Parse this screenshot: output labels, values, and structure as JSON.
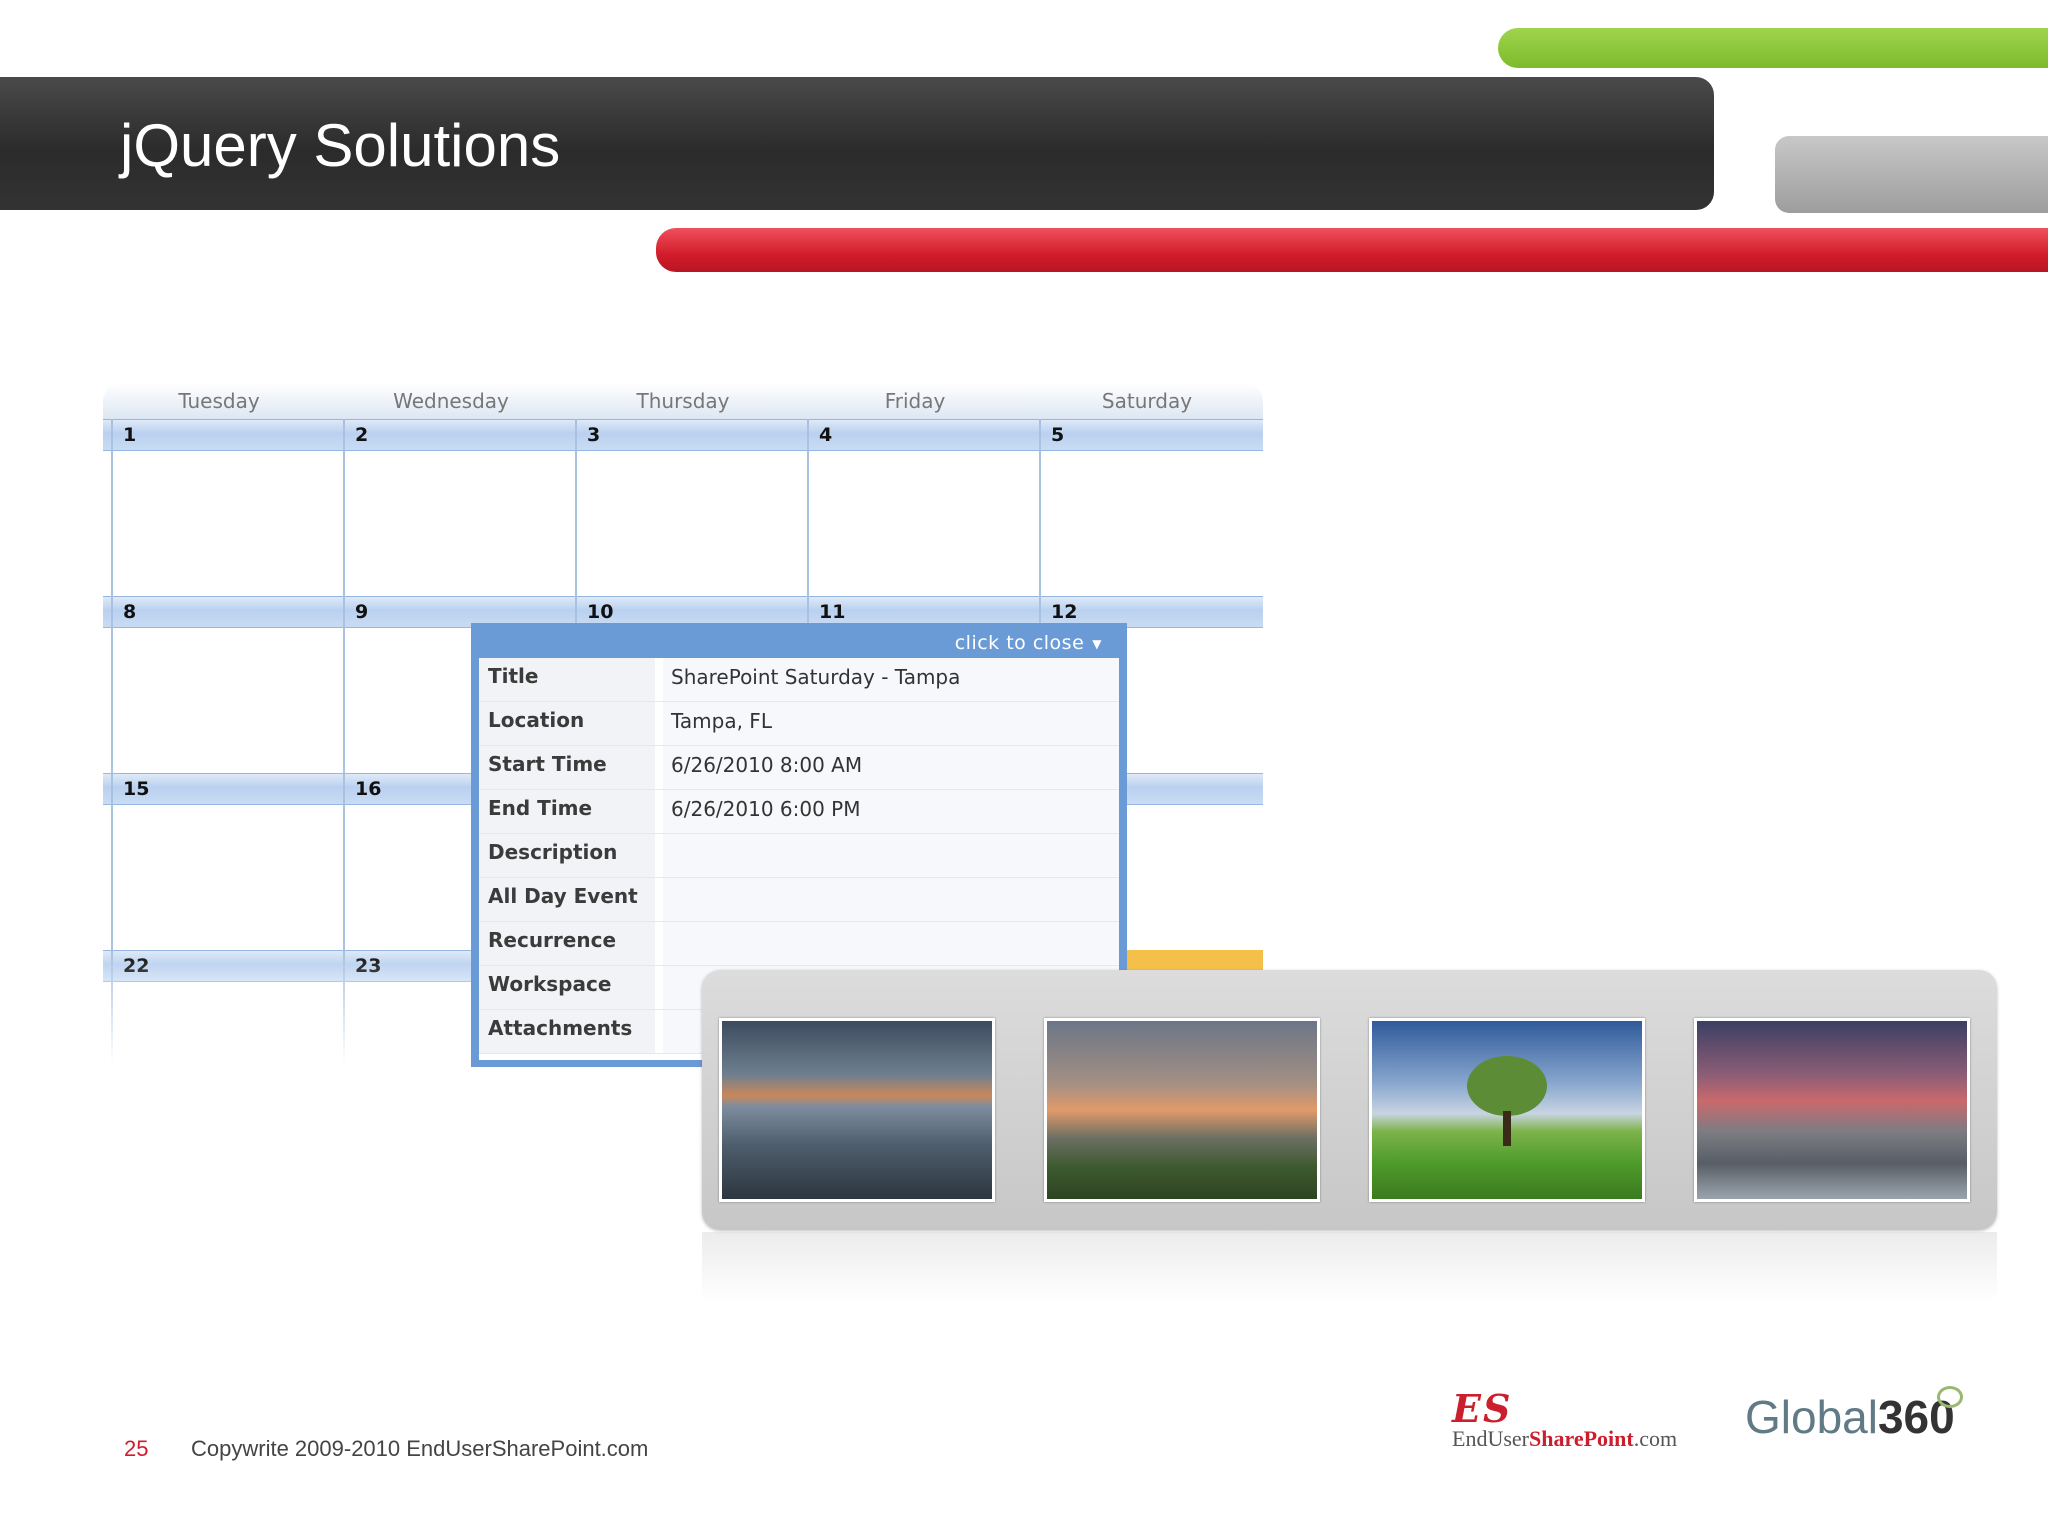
{
  "slide": {
    "title": "jQuery Solutions",
    "page_number": "25",
    "copyright": "Copywrite 2009-2010 EndUserSharePoint.com"
  },
  "calendar": {
    "day_names": [
      "Tuesday",
      "Wednesday",
      "Thursday",
      "Friday",
      "Saturday"
    ],
    "weeks": [
      [
        "1",
        "2",
        "3",
        "4",
        "5"
      ],
      [
        "8",
        "9",
        "10",
        "11",
        "12"
      ],
      [
        "15",
        "16",
        "",
        "",
        ""
      ],
      [
        "22",
        "23",
        "",
        "",
        ""
      ]
    ]
  },
  "popup": {
    "close_label": "click to close",
    "close_icon": "chevron-down-icon",
    "fields": [
      {
        "label": "Title",
        "value": "SharePoint Saturday - Tampa"
      },
      {
        "label": "Location",
        "value": "Tampa, FL"
      },
      {
        "label": "Start Time",
        "value": "6/26/2010 8:00 AM"
      },
      {
        "label": "End Time",
        "value": "6/26/2010 6:00 PM"
      },
      {
        "label": "Description",
        "value": ""
      },
      {
        "label": "All Day Event",
        "value": ""
      },
      {
        "label": "Recurrence",
        "value": ""
      },
      {
        "label": "Workspace",
        "value": ""
      },
      {
        "label": "Attachments",
        "value": ""
      }
    ]
  },
  "gallery": {
    "thumbnails": [
      "lake-at-dusk",
      "dead-tree-at-sunset",
      "tree-in-green-field",
      "rocky-shore-at-dusk"
    ]
  },
  "logos": {
    "es_mark": "ES",
    "es_text_1": "EndUser",
    "es_text_2": "SharePoint",
    "es_text_3": ".com",
    "g360_text_1": "Global",
    "g360_text_2": "360"
  },
  "colors": {
    "accent_red": "#cc1f2d",
    "accent_green": "#8cc63f",
    "calendar_blue": "#6b9bd7",
    "title_bar": "#333333"
  }
}
